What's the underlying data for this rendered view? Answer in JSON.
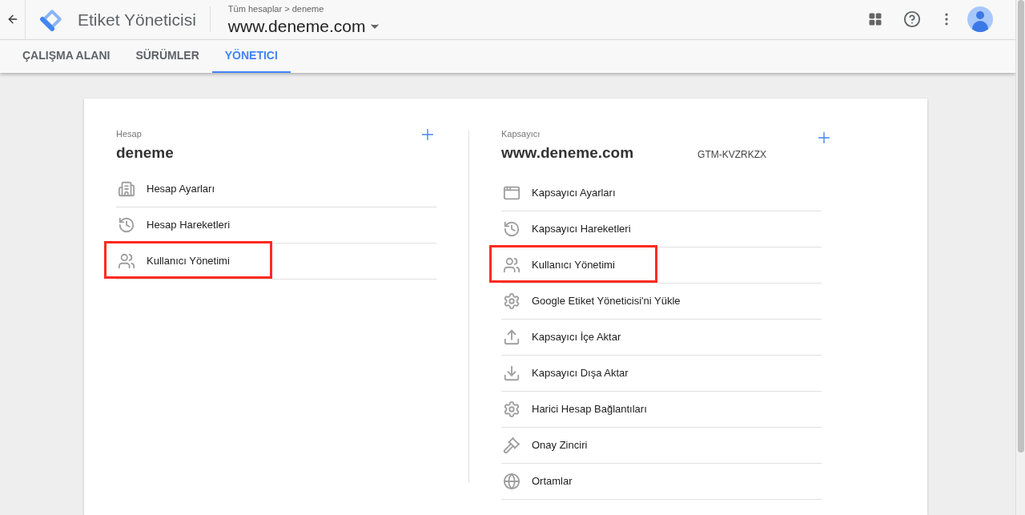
{
  "header": {
    "app_title": "Etiket Yöneticisi",
    "breadcrumb": "Tüm hesaplar > deneme",
    "container_name": "www.deneme.com"
  },
  "tabs": [
    {
      "label": "ÇALIŞMA ALANI",
      "selected": false
    },
    {
      "label": "SÜRÜMLER",
      "selected": false
    },
    {
      "label": "YÖNETICI",
      "selected": true
    }
  ],
  "account": {
    "caption": "Hesap",
    "name": "deneme",
    "items": [
      {
        "label": "Hesap Ayarları",
        "kind": "building",
        "highlighted": false
      },
      {
        "label": "Hesap Hareketleri",
        "kind": "history",
        "highlighted": false
      },
      {
        "label": "Kullanıcı Yönetimi",
        "kind": "people",
        "highlighted": true
      }
    ]
  },
  "container": {
    "caption": "Kapsayıcı",
    "name": "www.deneme.com",
    "id": "GTM-KVZRKZX",
    "items": [
      {
        "label": "Kapsayıcı Ayarları",
        "kind": "window",
        "highlighted": false
      },
      {
        "label": "Kapsayıcı Hareketleri",
        "kind": "history",
        "highlighted": false
      },
      {
        "label": "Kullanıcı Yönetimi",
        "kind": "people",
        "highlighted": true
      },
      {
        "label": "Google Etiket Yöneticisi'ni Yükle",
        "kind": "gear",
        "highlighted": false
      },
      {
        "label": "Kapsayıcı İçe Aktar",
        "kind": "upload",
        "highlighted": false
      },
      {
        "label": "Kapsayıcı Dışa Aktar",
        "kind": "download",
        "highlighted": false
      },
      {
        "label": "Harici Hesap Bağlantıları",
        "kind": "gear",
        "highlighted": false
      },
      {
        "label": "Onay Zinciri",
        "kind": "gavel",
        "highlighted": false
      },
      {
        "label": "Ortamlar",
        "kind": "globe",
        "highlighted": false
      }
    ]
  }
}
